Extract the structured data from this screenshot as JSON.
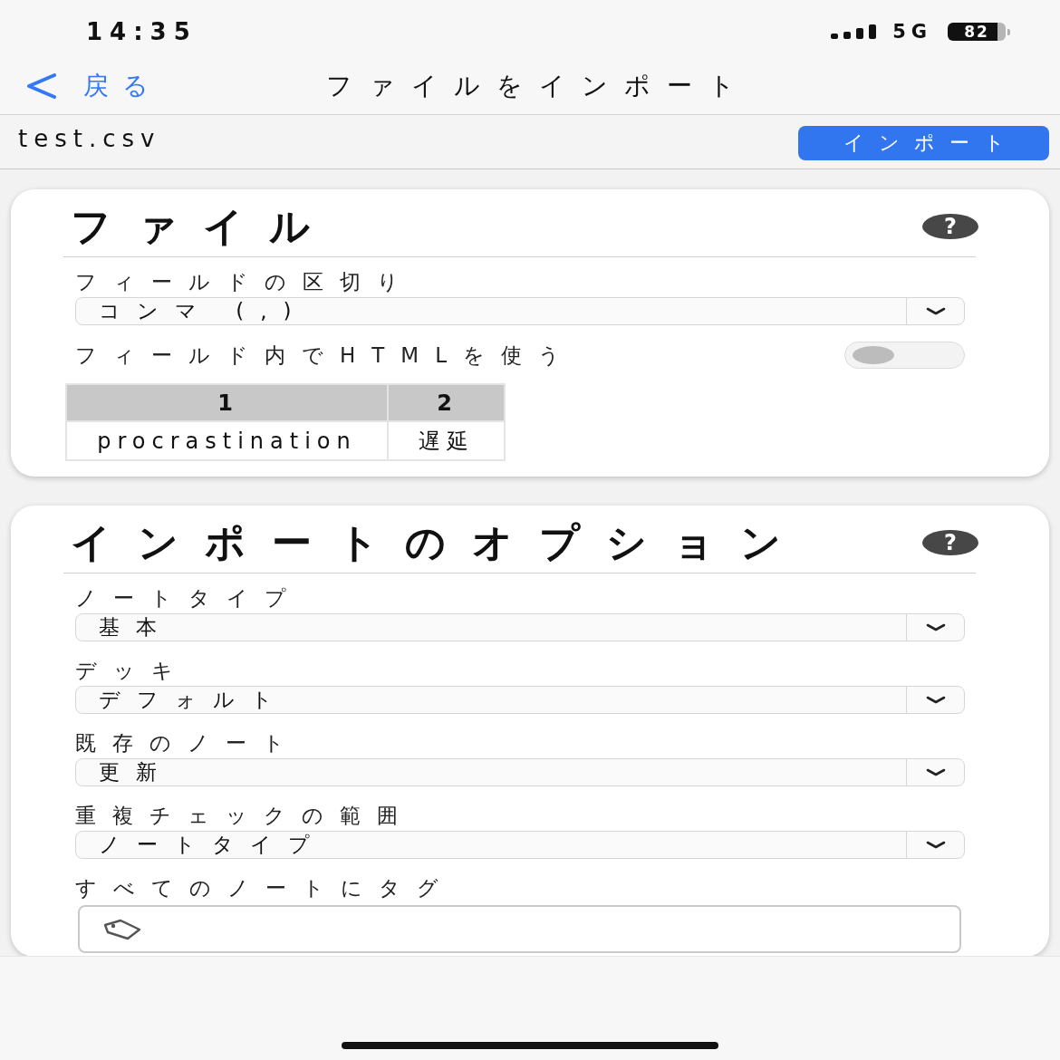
{
  "status_bar": {
    "time": "14:35",
    "network": "5G",
    "battery": "82"
  },
  "nav_bar": {
    "back_label": "戻る",
    "title": "ファイルをインポート"
  },
  "file_bar": {
    "file_name": "test.csv",
    "import_button": "インポート"
  },
  "sections": [
    {
      "title": "ファイル",
      "help": "?",
      "fields": [
        {
          "kind": "select",
          "label": "フィールドの区切り",
          "value": "コンマ (,)"
        },
        {
          "kind": "toggle",
          "label": "フィールド内でHTMLを使う",
          "on": false
        }
      ],
      "preview": {
        "columns": [
          "1",
          "2"
        ],
        "rows": [
          [
            "procrastination",
            "遅延"
          ]
        ]
      }
    },
    {
      "title": "インポートのオプション",
      "help": "?",
      "fields": [
        {
          "kind": "select",
          "label": "ノートタイプ",
          "value": "基本"
        },
        {
          "kind": "select",
          "label": "デッキ",
          "value": "デフォルト"
        },
        {
          "kind": "select",
          "label": "既存のノート",
          "value": "更新"
        },
        {
          "kind": "select",
          "label": "重複チェックの範囲",
          "value": "ノートタイプ"
        },
        {
          "kind": "tags",
          "label": "すべてのノートにタグ"
        }
      ]
    }
  ]
}
